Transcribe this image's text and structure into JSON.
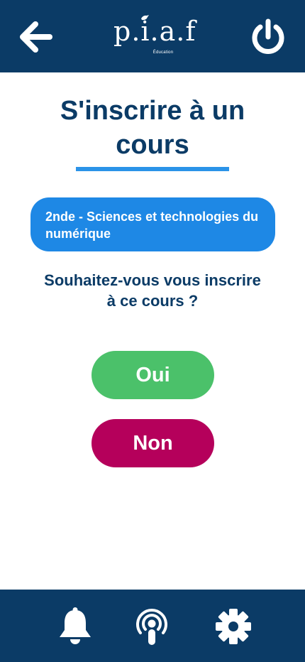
{
  "header": {
    "back_icon": "arrow-left-icon",
    "logo_text": "p.i.a.f",
    "logo_subtext": "Éducation",
    "power_icon": "power-icon"
  },
  "main": {
    "title": "S'inscrire à un cours",
    "course_name": "2nde - Sciences et technologies du numérique",
    "question": "Souhaitez-vous vous inscrire à ce cours ?",
    "yes_label": "Oui",
    "no_label": "Non"
  },
  "footer": {
    "items": [
      {
        "icon": "bell-icon"
      },
      {
        "icon": "podcast-icon"
      },
      {
        "icon": "gear-icon"
      }
    ]
  },
  "colors": {
    "primary": "#0b3b66",
    "accent": "#1e88e5",
    "yes": "#4bc16a",
    "no": "#b5005b"
  }
}
